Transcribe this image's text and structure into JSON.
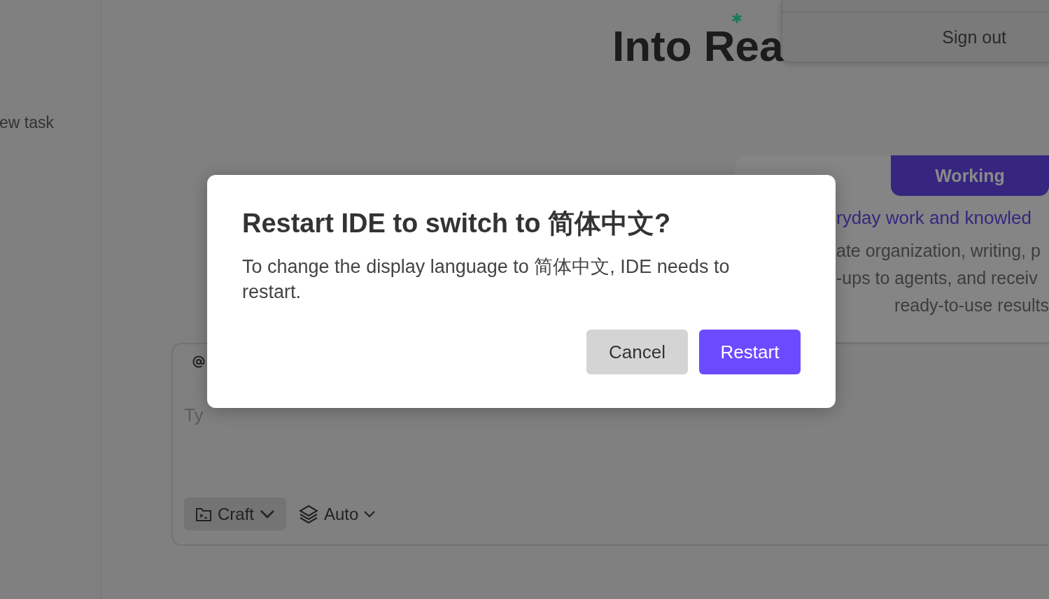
{
  "sidebar": {
    "items": [
      {
        "label": "ew task"
      }
    ]
  },
  "hero": {
    "heading": "Into Rea"
  },
  "account_menu": {
    "items": [
      {
        "label": "Sign out"
      }
    ]
  },
  "feature_card": {
    "tab": {
      "label": "Working",
      "selected": true
    },
    "subtitle": "ryday work and knowled",
    "description": [
      "ate organization, writing, p",
      "-ups to agents, and receiv",
      "ready-to-use results"
    ]
  },
  "composer": {
    "placeholder": "Ty",
    "mode": {
      "label": "Craft"
    },
    "model": {
      "label": "Auto"
    }
  },
  "dialog": {
    "title": "Restart IDE to switch to 简体中文?",
    "message": "To change the display language to 简体中文, IDE needs to restart.",
    "buttons": [
      {
        "label": "Cancel",
        "kind": "secondary"
      },
      {
        "label": "Restart",
        "kind": "primary"
      }
    ]
  }
}
